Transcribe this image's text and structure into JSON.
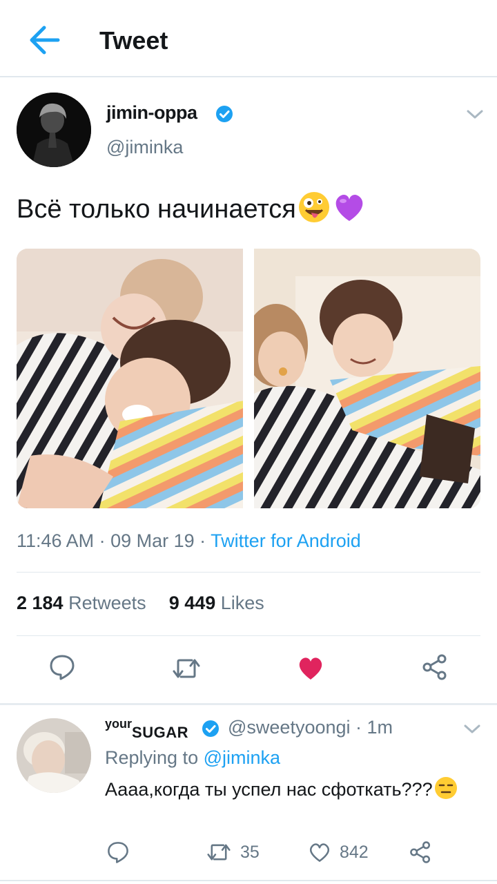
{
  "header": {
    "title": "Tweet",
    "back_icon": "arrow-left-icon"
  },
  "tweet": {
    "display_name": "jimin-oppa",
    "handle": "@jiminka",
    "text": "Всё только начинается",
    "emojis": [
      "zany-face-emoji",
      "purple-heart-emoji"
    ],
    "time": "11:46 AM",
    "date": "09 Mar 19",
    "separator": " · ",
    "source": "Twitter for Android",
    "retweets_count": "2 184",
    "retweets_label": "Retweets",
    "likes_count": "9 449",
    "likes_label": "Likes",
    "photo_count": 2
  },
  "reply": {
    "name_super": "your",
    "name_main": "SUGAR",
    "handle": "@sweetyoongi",
    "time": "1m",
    "replying_prefix": "Replying to",
    "replying_to": "@jiminka",
    "text": "Аааа,когда ты успел нас сфоткать???",
    "emoji": "expressionless-face-emoji",
    "retweet_count": "35",
    "like_count": "842"
  },
  "colors": {
    "accent": "#1da1f2",
    "like": "#e0245e",
    "muted": "#657786",
    "text": "#14171a",
    "divider": "#e1e8ed"
  }
}
